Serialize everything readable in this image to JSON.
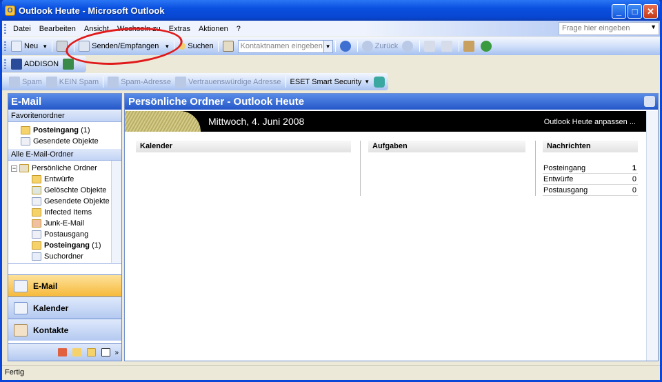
{
  "window": {
    "title": "Outlook Heute - Microsoft Outlook"
  },
  "menu": {
    "items": [
      "Datei",
      "Bearbeiten",
      "Ansicht",
      "Wechseln zu",
      "Extras",
      "Aktionen",
      "?"
    ],
    "help_placeholder": "Frage hier eingeben"
  },
  "toolbar": {
    "new_label": "Neu",
    "send_receive_label": "Senden/Empfangen",
    "search_label": "Suchen",
    "contact_placeholder": "Kontaktnamen eingeben",
    "back_label": "Zurück"
  },
  "addison_label": "ADDISON",
  "eset_toolbar": {
    "spam": "Spam",
    "not_spam": "KEIN Spam",
    "spam_address": "Spam-Adresse",
    "trusted_address": "Vertrauenswürdige Adresse",
    "eset": "ESET Smart Security"
  },
  "nav": {
    "title": "E-Mail",
    "favorites_header": "Favoritenordner",
    "favorites": [
      {
        "name": "Posteingang",
        "count": "(1)"
      },
      {
        "name": "Gesendete Objekte"
      }
    ],
    "all_header": "Alle E-Mail-Ordner",
    "root": "Persönliche Ordner",
    "folders": [
      {
        "name": "Entwürfe"
      },
      {
        "name": "Gelöschte Objekte"
      },
      {
        "name": "Gesendete Objekte"
      },
      {
        "name": "Infected Items"
      },
      {
        "name": "Junk-E-Mail"
      },
      {
        "name": "Postausgang"
      },
      {
        "name": "Posteingang",
        "count": "(1)"
      },
      {
        "name": "Suchordner"
      }
    ],
    "buttons": {
      "mail": "E-Mail",
      "calendar": "Kalender",
      "contacts": "Kontakte"
    }
  },
  "main": {
    "title": "Persönliche Ordner - Outlook Heute",
    "date": "Mittwoch, 4. Juni 2008",
    "customize": "Outlook Heute anpassen ...",
    "calendar_header": "Kalender",
    "tasks_header": "Aufgaben",
    "messages_header": "Nachrichten",
    "messages": [
      {
        "name": "Posteingang",
        "count": "1"
      },
      {
        "name": "Entwürfe",
        "count": "0"
      },
      {
        "name": "Postausgang",
        "count": "0"
      }
    ]
  },
  "status": "Fertig"
}
